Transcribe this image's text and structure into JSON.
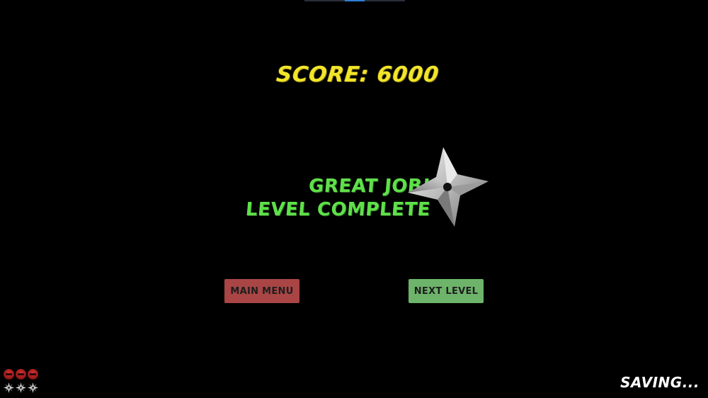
{
  "hud": {
    "score_text": "SCORE: 6000",
    "saving_text": "SAVING..."
  },
  "result": {
    "line1": "GREAT JOB!",
    "line2": "LEVEL COMPLETE"
  },
  "buttons": {
    "main_menu": "MAIN MENU",
    "next_level": "NEXT LEVEL"
  },
  "inventory": {
    "lives_count": 3,
    "shuriken_count": 3,
    "life_icon": "ninja-head-icon",
    "shuriken_icon": "shuriken-icon"
  },
  "colors": {
    "background": "#000000",
    "score": "#f2e52a",
    "message": "#5fe04a",
    "main_menu_button": "#a94545",
    "next_level_button": "#6db46a",
    "saving": "#ffffff"
  }
}
